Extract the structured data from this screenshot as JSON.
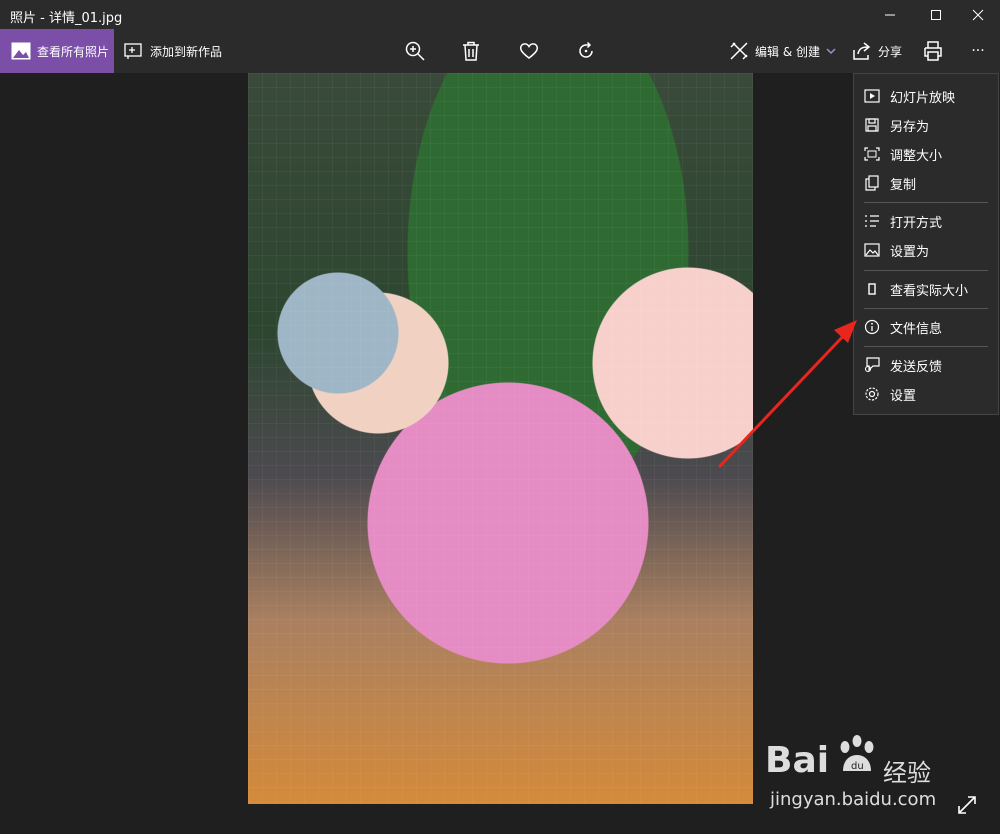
{
  "window": {
    "title": "照片 - 详情_01.jpg",
    "minimize": "minimize-icon",
    "maximize": "maximize-icon",
    "close": "close-icon"
  },
  "toolbar": {
    "view_all": "查看所有照片",
    "add_to_creation": "添加到新作品",
    "edit_create": "编辑 & 创建",
    "share": "分享",
    "more": "···",
    "accent": "#7b4fa8"
  },
  "menu": {
    "items": [
      {
        "label": "幻灯片放映",
        "icon": "slideshow-icon"
      },
      {
        "label": "另存为",
        "icon": "save-icon"
      },
      {
        "label": "调整大小",
        "icon": "resize-icon"
      },
      {
        "label": "复制",
        "icon": "copy-icon"
      },
      {
        "label": "打开方式",
        "icon": "open-with-icon"
      },
      {
        "label": "设置为",
        "icon": "set-as-icon"
      },
      {
        "label": "查看实际大小",
        "icon": "actual-size-icon"
      },
      {
        "label": "文件信息",
        "icon": "info-icon"
      },
      {
        "label": "发送反馈",
        "icon": "feedback-icon"
      },
      {
        "label": "设置",
        "icon": "settings-icon"
      }
    ]
  },
  "watermark": {
    "brand": "Bai",
    "product": "经验",
    "url": "jingyan.baidu.com"
  },
  "annotation_color": "#e8261e"
}
